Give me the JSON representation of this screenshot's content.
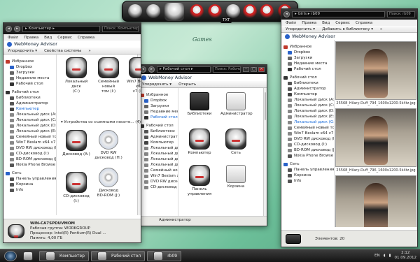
{
  "desktop": {
    "games_label": "Games",
    "dock_label": "TXT"
  },
  "left": {
    "address": "▸ Компьютер ▸",
    "search_placeholder": "Поиск: Компьютер",
    "menu": [
      "Файл",
      "Правка",
      "Вид",
      "Сервис",
      "Справка"
    ],
    "toolbar": [
      "Упорядочить ▾",
      "Свойства системы",
      "»"
    ],
    "webmoney": "WebMoney Advisor",
    "sidebar": [
      {
        "label": "Избранное",
        "kind": "grp",
        "color": "#c0392b"
      },
      {
        "label": "Dropbox",
        "kind": "sub",
        "color": "#2a62c9"
      },
      {
        "label": "Загрузки",
        "kind": "sub",
        "color": "#666"
      },
      {
        "label": "Недавние места",
        "kind": "sub",
        "color": "#777"
      },
      {
        "label": "Рабочий стол",
        "kind": "sub",
        "color": "#333"
      },
      {
        "label": "Рабочий стол",
        "kind": "grp",
        "color": "#333"
      },
      {
        "label": "Библиотеки",
        "kind": "sub",
        "color": "#555"
      },
      {
        "label": "Администратор",
        "kind": "sub",
        "color": "#555"
      },
      {
        "label": "Компьютер",
        "kind": "sub sel",
        "color": "#444"
      },
      {
        "label": "Локальный диск (A:)",
        "kind": "sub",
        "color": "#888"
      },
      {
        "label": "Локальный диск (C:)",
        "kind": "sub",
        "color": "#888"
      },
      {
        "label": "Локальный диск (D:)",
        "kind": "sub",
        "color": "#888"
      },
      {
        "label": "Локальный диск (E:)",
        "kind": "sub",
        "color": "#888"
      },
      {
        "label": "Семейный новый том (",
        "kind": "sub",
        "color": "#888"
      },
      {
        "label": "Win7 Beslam x64 v7 (",
        "kind": "sub",
        "color": "#888"
      },
      {
        "label": "DVD RW дисковод (H:)",
        "kind": "sub",
        "color": "#888"
      },
      {
        "label": "CD-дисковод (I:)",
        "kind": "sub",
        "color": "#888"
      },
      {
        "label": "BD-ROM дисковод (J:",
        "kind": "sub",
        "color": "#888"
      },
      {
        "label": "Nokia Phone Browse",
        "kind": "sub",
        "color": "#555"
      },
      {
        "label": "Сеть",
        "kind": "grp",
        "color": "#2a62c9"
      },
      {
        "label": "Панель управления",
        "kind": "sub",
        "color": "#555"
      },
      {
        "label": "Корзина",
        "kind": "sub",
        "color": "#555"
      },
      {
        "label": "Info",
        "kind": "sub",
        "color": "#555"
      }
    ],
    "drives_row1": [
      {
        "label": "Локальный диск\n(C:)"
      },
      {
        "label": "Семейный новый\nтом (I:)"
      },
      {
        "label": "Win7 Beslam x64\nv7 (H:)"
      }
    ],
    "removable_header": "▾ Устройства со съемными носите... (4)",
    "drives_row2": [
      {
        "label": "Дисковод (A:)"
      },
      {
        "label": "DVD RW\nдисковод (H:)"
      },
      {
        "label": "CD-дисковод (I:)"
      },
      {
        "label": "Дисковод\nBD-ROM (J:)"
      }
    ],
    "status": {
      "name": "WIN-CA7SPDUVMOM",
      "l1k": "Рабочая группа:",
      "l1v": "WORKGROUP",
      "l2k": "Процессор:",
      "l2v": "Intel(R) Pentium(R) Dual ...",
      "l3k": "Память:",
      "l3v": "4,00 ГБ"
    }
  },
  "middle": {
    "address": "▸ Рабочий стол ▸",
    "search_placeholder": "Поиск: Рабочий стол",
    "webmoney": "WebMoney Advisor",
    "toolbar": [
      "Упорядочить ▾",
      "Открыть"
    ],
    "sidebar": [
      {
        "label": "Избранное",
        "kind": "grp",
        "color": "#c0392b"
      },
      {
        "label": "Dropbox",
        "kind": "sub",
        "color": "#2a62c9"
      },
      {
        "label": "Загрузки",
        "kind": "sub",
        "color": "#666"
      },
      {
        "label": "Недавние места",
        "kind": "sub",
        "color": "#777"
      },
      {
        "label": "Рабочий стол",
        "kind": "sub sel",
        "color": "#333"
      },
      {
        "label": "Рабочий стол",
        "kind": "grp",
        "color": "#333"
      },
      {
        "label": "Библиотеки",
        "kind": "sub",
        "color": "#555"
      },
      {
        "label": "Администратор",
        "kind": "sub",
        "color": "#555"
      },
      {
        "label": "Компьютер",
        "kind": "sub",
        "color": "#444"
      },
      {
        "label": "Локальный диск (A:)",
        "kind": "sub",
        "color": "#888"
      },
      {
        "label": "Локальный диск (C:)",
        "kind": "sub",
        "color": "#888"
      },
      {
        "label": "Локальный диск (D:)",
        "kind": "sub",
        "color": "#888"
      },
      {
        "label": "Локальный диск (E:)",
        "kind": "sub",
        "color": "#888"
      },
      {
        "label": "Семейный новый том",
        "kind": "sub",
        "color": "#888"
      },
      {
        "label": "Win7 Beslam x64 v7",
        "kind": "sub",
        "color": "#888"
      },
      {
        "label": "DVD RW дисковод (H:",
        "kind": "sub",
        "color": "#888"
      },
      {
        "label": "CD-дисковод (I:)",
        "kind": "sub",
        "color": "#888"
      }
    ],
    "items": [
      {
        "label": "Библиотеки",
        "kind": "folder"
      },
      {
        "label": "Администратор",
        "kind": "folder w"
      },
      {
        "label": "Компьютер",
        "kind": "drv"
      },
      {
        "label": "Сеть",
        "kind": "drv"
      },
      {
        "label": "Панель\nуправления",
        "kind": "drv"
      },
      {
        "label": "Корзина",
        "kind": "folder w"
      }
    ],
    "status": "Администратор"
  },
  "right": {
    "address": "▸ Girls ▸ rb09",
    "search_placeholder": "Поиск: rb09",
    "menu": [
      "Файл",
      "Правка",
      "Вид",
      "Сервис",
      "Справка"
    ],
    "toolbar": [
      "Упорядочить ▾",
      "Добавить в библиотеку ▾",
      "»"
    ],
    "webmoney": "WebMoney Advisor",
    "sidebar": [
      {
        "label": "Избранное",
        "kind": "grp",
        "color": "#c0392b"
      },
      {
        "label": "Dropbox",
        "kind": "sub",
        "color": "#2a62c9"
      },
      {
        "label": "Загрузки",
        "kind": "sub",
        "color": "#666"
      },
      {
        "label": "Недавние места",
        "kind": "sub",
        "color": "#777"
      },
      {
        "label": "Рабочий стол",
        "kind": "sub",
        "color": "#333"
      },
      {
        "label": "Рабочий стол",
        "kind": "grp",
        "color": "#333"
      },
      {
        "label": "Библиотеки",
        "kind": "sub",
        "color": "#555"
      },
      {
        "label": "Администратор",
        "kind": "sub",
        "color": "#555"
      },
      {
        "label": "Компьютер",
        "kind": "sub",
        "color": "#444"
      },
      {
        "label": "Локальный диск (A:)",
        "kind": "sub",
        "color": "#888"
      },
      {
        "label": "Локальный диск (C:)",
        "kind": "sub",
        "color": "#888"
      },
      {
        "label": "Локальный диск (D:)",
        "kind": "sub",
        "color": "#888"
      },
      {
        "label": "Локальный диск (E:)",
        "kind": "sub",
        "color": "#888"
      },
      {
        "label": "Локальный диск (G:)",
        "kind": "sub sel",
        "color": "#888"
      },
      {
        "label": "Семейный новый том",
        "kind": "sub",
        "color": "#888"
      },
      {
        "label": "Win7 Beslam x64 v7",
        "kind": "sub",
        "color": "#888"
      },
      {
        "label": "DVD RW дисковод (H:",
        "kind": "sub",
        "color": "#888"
      },
      {
        "label": "CD-дисковод (I:)",
        "kind": "sub",
        "color": "#888"
      },
      {
        "label": "BD-ROM дисковод (J:",
        "kind": "sub",
        "color": "#888"
      },
      {
        "label": "Nokia Phone Browse",
        "kind": "sub",
        "color": "#555"
      },
      {
        "label": "Сеть",
        "kind": "grp",
        "color": "#2a62c9"
      },
      {
        "label": "Панель управления",
        "kind": "sub",
        "color": "#555"
      },
      {
        "label": "Корзина",
        "kind": "sub",
        "color": "#555"
      },
      {
        "label": "Info",
        "kind": "sub",
        "color": "#555"
      }
    ],
    "thumbs": [
      {
        "caption": "25568_Hilary-Duff_794_1600x1200-5k4tz.jpg"
      },
      {
        "caption": "25568_Hilary-Duff_796_1600x1200-5k4tz.jpg"
      },
      {
        "caption": ""
      }
    ],
    "status": "Элементов: 20"
  },
  "taskbar": {
    "tasks": [
      {
        "label": "Компьютер",
        "active": true
      },
      {
        "label": "Рабочий стол",
        "active": true
      },
      {
        "label": "rb09",
        "active": true
      }
    ],
    "lang": "EN",
    "time": "2:12",
    "date": "01.09.2012"
  }
}
